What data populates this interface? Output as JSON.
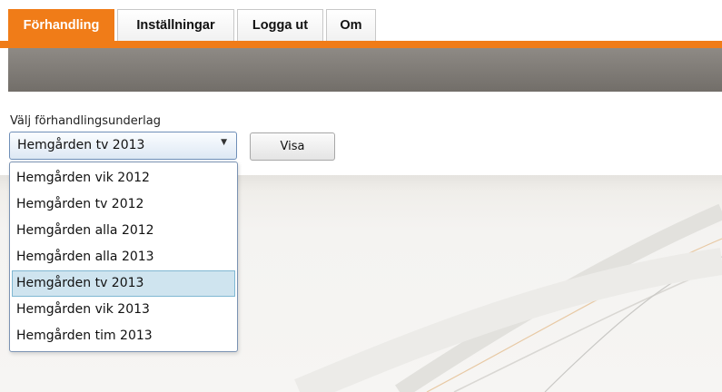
{
  "tabs": [
    {
      "label": "Förhandling",
      "active": true
    },
    {
      "label": "Inställningar",
      "active": false
    },
    {
      "label": "Logga ut",
      "active": false
    },
    {
      "label": "Om",
      "active": false
    }
  ],
  "form": {
    "label": "Välj förhandlingsunderlag",
    "selected": "Hemgården tv 2013",
    "button": "Visa",
    "options": [
      "Hemgården vik 2012",
      "Hemgården tv 2012",
      "Hemgården alla 2012",
      "Hemgården alla 2013",
      "Hemgården tv 2013",
      "Hemgården vik 2013",
      "Hemgården tim 2013"
    ],
    "selected_index": 4
  },
  "colors": {
    "accent": "#f07c18",
    "band": "#7f7b76",
    "selected_option": "#cfe4ef"
  },
  "icons": {
    "dropdown_arrow": "chevron-down-icon"
  }
}
